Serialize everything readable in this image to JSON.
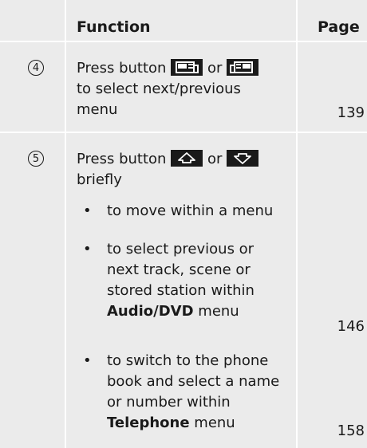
{
  "header": {
    "function": "Function",
    "page": "Page"
  },
  "rows": [
    {
      "num": "4",
      "line1_pre": "Press button",
      "line1_or": "or",
      "line2": "to select next/previous",
      "line3": "menu",
      "page": "139",
      "buttons": [
        "menu-previous-icon",
        "menu-next-icon"
      ]
    },
    {
      "num": "5",
      "line1_pre": "Press button",
      "line1_or": "or",
      "line2": "briefly",
      "buttons": [
        "arrow-up-icon",
        "arrow-down-icon"
      ],
      "bullets": [
        {
          "marker": "•",
          "lines": [
            "to move within a menu"
          ],
          "page": ""
        },
        {
          "marker": "•",
          "lines": [
            "to select previous or",
            "next track, scene or",
            "stored station within"
          ],
          "bold": "Audio/DVD",
          "after_bold": " menu",
          "page": "146"
        },
        {
          "marker": "•",
          "lines": [
            "to switch to the phone",
            "book and select a name",
            "or number within"
          ],
          "bold": "Telephone",
          "after_bold": " menu",
          "page": "158"
        }
      ]
    }
  ],
  "colors": {
    "row_bg": "#ebebeb",
    "text": "#1a1a1a",
    "button_bg": "#1a1a1a"
  }
}
